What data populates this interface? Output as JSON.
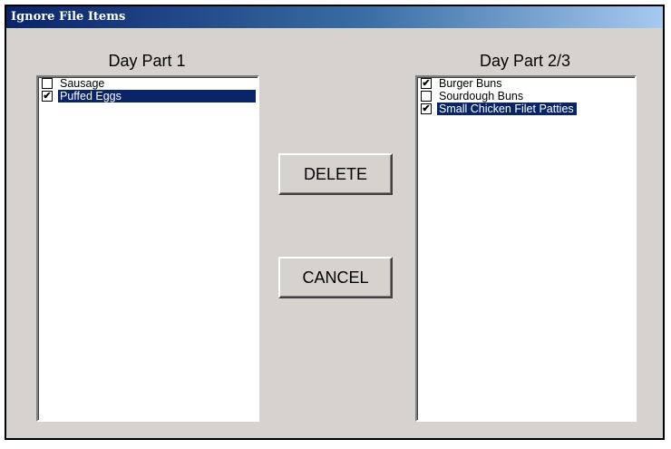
{
  "window": {
    "title": "Ignore File Items"
  },
  "left_list": {
    "label": "Day Part 1",
    "items": [
      {
        "label": "Sausage",
        "checked": false,
        "selected": false
      },
      {
        "label": "Puffed Eggs",
        "checked": true,
        "selected": true
      }
    ]
  },
  "right_list": {
    "label": "Day Part 2/3",
    "items": [
      {
        "label": "Burger Buns",
        "checked": true,
        "selected": false
      },
      {
        "label": "Sourdough Buns",
        "checked": false,
        "selected": false
      },
      {
        "label": "Small Chicken Filet Patties",
        "checked": true,
        "selected": true
      }
    ]
  },
  "buttons": {
    "delete": "DELETE",
    "cancel": "CANCEL"
  },
  "colors": {
    "selection": "#0a246a",
    "dialog_bg": "#d6d3ce"
  }
}
